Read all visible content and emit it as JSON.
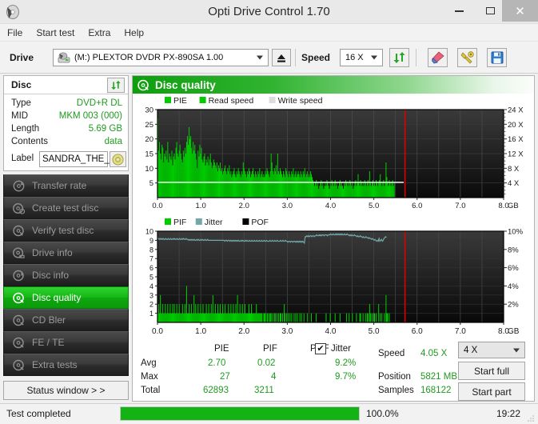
{
  "window": {
    "title": "Opti Drive Control 1.70",
    "icon": "disc-icon",
    "minimize": "–",
    "maximize": "□",
    "close": "✕"
  },
  "menu": {
    "items": [
      "File",
      "Start test",
      "Extra",
      "Help"
    ]
  },
  "toolbar": {
    "drive_label": "Drive",
    "drive_value": "(M:)   PLEXTOR DVDR   PX-890SA 1.00",
    "eject_icon": "eject-icon",
    "speed_label": "Speed",
    "speed_value": "16 X",
    "refresh_icon": "refresh-icon",
    "erase_icon": "erase-icon",
    "tools_icon": "tools-icon",
    "save_icon": "save-icon"
  },
  "disc_panel": {
    "header": "Disc",
    "refresh_icon": "refresh-icon",
    "rows": [
      {
        "key": "Type",
        "value": "DVD+R DL"
      },
      {
        "key": "MID",
        "value": "MKM 003 (000)"
      },
      {
        "key": "Length",
        "value": "5.69 GB"
      },
      {
        "key": "Contents",
        "value": "data"
      }
    ],
    "label_key": "Label",
    "label_value": "SANDRA_THE_",
    "label_button_icon": "disc-icon"
  },
  "sidebar": {
    "items": [
      {
        "label": "Transfer rate",
        "icon": "disc-transfer-icon",
        "active": false
      },
      {
        "label": "Create test disc",
        "icon": "disc-create-icon",
        "active": false
      },
      {
        "label": "Verify test disc",
        "icon": "disc-verify-icon",
        "active": false
      },
      {
        "label": "Drive info",
        "icon": "disc-drive-icon",
        "active": false
      },
      {
        "label": "Disc info",
        "icon": "disc-info-icon",
        "active": false
      },
      {
        "label": "Disc quality",
        "icon": "disc-quality-icon",
        "active": true
      },
      {
        "label": "CD Bler",
        "icon": "disc-bler-icon",
        "active": false
      },
      {
        "label": "FE / TE",
        "icon": "disc-fete-icon",
        "active": false
      },
      {
        "label": "Extra tests",
        "icon": "disc-extra-icon",
        "active": false
      }
    ],
    "status_window_button": "Status window > >"
  },
  "main": {
    "header_title": "Disc quality",
    "header_icon": "disc-quality-icon"
  },
  "stats": {
    "col_headers": [
      "PIE",
      "PIF",
      "POF",
      "Jitter"
    ],
    "jitter_checked": "✔",
    "rows": [
      {
        "name": "Avg",
        "pie": "2.70",
        "pif": "0.02",
        "pof": "",
        "jitter": "9.2%"
      },
      {
        "name": "Max",
        "pie": "27",
        "pif": "4",
        "pof": "",
        "jitter": "9.7%"
      },
      {
        "name": "Total",
        "pie": "62893",
        "pif": "3211",
        "pof": "",
        "jitter": ""
      }
    ],
    "speed_key": "Speed",
    "speed_value": "4.05 X",
    "position_key": "Position",
    "position_value": "5821 MB",
    "samples_key": "Samples",
    "samples_value": "168122",
    "test_speed_select": "4 X",
    "start_full_button": "Start full",
    "start_part_button": "Start part"
  },
  "statusbar": {
    "message": "Test completed",
    "progress_percent": 100.0,
    "progress_text": "100.0%",
    "elapsed": "19:22"
  },
  "colors": {
    "pie_green": "#00cc00",
    "pif_green": "#3fd820",
    "jitter_teal": "#72a8a8",
    "pof_black": "#000000",
    "marker_red": "#dd0000",
    "avg_line_white": "#ffffff",
    "plot_bg_dark": "#1d1d1d",
    "accent_green": "#16b816"
  },
  "chart_data": [
    {
      "id": "pie-chart",
      "type": "area",
      "title": "PIE",
      "legend": [
        "PIE",
        "Read speed",
        "Write speed"
      ],
      "legend_colors": [
        "#00cc00",
        "#00cc00",
        "#dcdcdc"
      ],
      "xlabel": "GB",
      "xlim": [
        0.0,
        8.0
      ],
      "xticks": [
        "0.0",
        "1.0",
        "2.0",
        "3.0",
        "4.0",
        "5.0",
        "6.0",
        "7.0",
        "8.0"
      ],
      "ylabel_left": "PIE",
      "ylim": [
        0,
        30
      ],
      "yticks": [
        5,
        10,
        15,
        20,
        25,
        30
      ],
      "ylabel_right": "Speed",
      "ylim_right": [
        0,
        24
      ],
      "yticks_right": [
        "4 X",
        "8 X",
        "12 X",
        "16 X",
        "20 X",
        "24 X"
      ],
      "avg_line": 2.7,
      "read_speed_line_x": 4.0,
      "data_end_gb": 5.69,
      "marker_line_gb": 5.72,
      "grid": true,
      "values": [
        27,
        16,
        19,
        15,
        13,
        18,
        17,
        12,
        15,
        14,
        16,
        13,
        19,
        12,
        15,
        14,
        13,
        16,
        11,
        14,
        15,
        13,
        17,
        19,
        15,
        14,
        16,
        18,
        15,
        13,
        12,
        16,
        14,
        17,
        15,
        19,
        21,
        18,
        24,
        20,
        21,
        17,
        15,
        19,
        16,
        18,
        15,
        13,
        10,
        16,
        14,
        18,
        15,
        17,
        13,
        12,
        14,
        15,
        11,
        13,
        12,
        14,
        11,
        13,
        15,
        12,
        10,
        11,
        13,
        12,
        11,
        10,
        12,
        9,
        11,
        10,
        12,
        9,
        10,
        8,
        9,
        10,
        11,
        9,
        8,
        10,
        9,
        11,
        8,
        9,
        7,
        8,
        9,
        10,
        8,
        7,
        9,
        8,
        10,
        9,
        8,
        7,
        9,
        8,
        12,
        10,
        9,
        8,
        7,
        9,
        8,
        10,
        9,
        7,
        8,
        9,
        10,
        8,
        7,
        9,
        8,
        7,
        9,
        8,
        10,
        7,
        8,
        9,
        7,
        8,
        7,
        9,
        8,
        10,
        9,
        8,
        7,
        9,
        15,
        12,
        9,
        8,
        10,
        9,
        11,
        8,
        15,
        9,
        8,
        10,
        9,
        8,
        7,
        9,
        8,
        7,
        10,
        9,
        8,
        7,
        9,
        8,
        7,
        9,
        8,
        10,
        7,
        8,
        9,
        7,
        8,
        9,
        8,
        7,
        9,
        8,
        7,
        9,
        8,
        10,
        7,
        8,
        9,
        7,
        8,
        7,
        9,
        8,
        7,
        6,
        5,
        4,
        5,
        6,
        4,
        5,
        3,
        4,
        5,
        6,
        4,
        5,
        3,
        4,
        5,
        4,
        6,
        5,
        4,
        3,
        5,
        4,
        6,
        5,
        4,
        5,
        6,
        4,
        5,
        3,
        4,
        5,
        6,
        4,
        5,
        4,
        3,
        5,
        4,
        6,
        5,
        4,
        5,
        4,
        6,
        5,
        4,
        5,
        3,
        4,
        5,
        6,
        4,
        5,
        8,
        5,
        4,
        6,
        5,
        4,
        5,
        4,
        6,
        5,
        4,
        5,
        6,
        4,
        9,
        5,
        4,
        5,
        6,
        4,
        5,
        4,
        6,
        5,
        4,
        5,
        6,
        8,
        5,
        4,
        5,
        6,
        4,
        5,
        12,
        7,
        5,
        4,
        6,
        5,
        4,
        5,
        6,
        4,
        5,
        0,
        0,
        0,
        0,
        0,
        0,
        0,
        0,
        0,
        0,
        0
      ]
    },
    {
      "id": "pif-jitter-chart",
      "type": "line+bar",
      "title": "PIF / Jitter / POF",
      "legend": [
        "PIF",
        "Jitter",
        "POF"
      ],
      "legend_colors": [
        "#00cc00",
        "#72a8a8",
        "#000000"
      ],
      "xlabel": "GB",
      "xlim": [
        0.0,
        8.0
      ],
      "xticks": [
        "0.0",
        "1.0",
        "2.0",
        "3.0",
        "4.0",
        "5.0",
        "6.0",
        "7.0",
        "8.0"
      ],
      "ylabel_left": "PIF",
      "ylim": [
        0,
        10
      ],
      "yticks": [
        1,
        2,
        3,
        4,
        5,
        6,
        7,
        8,
        9,
        10
      ],
      "ylabel_right": "Jitter",
      "ylim_right": [
        0,
        10
      ],
      "yticks_right": [
        "2%",
        "4%",
        "6%",
        "8%",
        "10%"
      ],
      "data_end_gb": 5.69,
      "marker_line_gb": 5.72,
      "grid": true,
      "series": [
        {
          "name": "PIF",
          "values": [
            1,
            2,
            1,
            3,
            1,
            1,
            2,
            1,
            1,
            2,
            1,
            1,
            2,
            1,
            1,
            2,
            1,
            1,
            2,
            1,
            2,
            1,
            1,
            2,
            1,
            1,
            2,
            1,
            1,
            1,
            2,
            1,
            1,
            2,
            1,
            4,
            1,
            1,
            2,
            1,
            1,
            2,
            1,
            1,
            3,
            1,
            2,
            1,
            1,
            2,
            1,
            1,
            2,
            1,
            1,
            2,
            1,
            1,
            1,
            2,
            1,
            1,
            2,
            1,
            1,
            2,
            1,
            3,
            1,
            1,
            2,
            1,
            1,
            2,
            1,
            1,
            2,
            1,
            1,
            2,
            1,
            1,
            2,
            1,
            1,
            1,
            2,
            1,
            1,
            2,
            1,
            1,
            2,
            1,
            1,
            2,
            1,
            3,
            1,
            1,
            2,
            1,
            1,
            2,
            1,
            1,
            2,
            1,
            1,
            1,
            1,
            2,
            1,
            1,
            2,
            1,
            1,
            1,
            1,
            1,
            2,
            1,
            1,
            1,
            1,
            1,
            1,
            1,
            0,
            1,
            1,
            1,
            0,
            1,
            1,
            0,
            1,
            1,
            1,
            0,
            1,
            0,
            1,
            1,
            0,
            1,
            0,
            1,
            0,
            1,
            1,
            0,
            1,
            0,
            2,
            1,
            0,
            1,
            0,
            1,
            0,
            1,
            0,
            1,
            0,
            0,
            1,
            0,
            1,
            0,
            1,
            0,
            0,
            1,
            0,
            1,
            0,
            0,
            1,
            0,
            0,
            0,
            1,
            0,
            0,
            0,
            0,
            1,
            0,
            0,
            0,
            0,
            0,
            1,
            0,
            0,
            0,
            0,
            0,
            0,
            0,
            0,
            0,
            0,
            0,
            1,
            0,
            0,
            0,
            0,
            1,
            0,
            0,
            0,
            0,
            0,
            1,
            0,
            0,
            0,
            0,
            0,
            1,
            0,
            0,
            0,
            0,
            0,
            0,
            0,
            1,
            0,
            0,
            1,
            0,
            0,
            0,
            1,
            0,
            0,
            0,
            0,
            1,
            0,
            0,
            0,
            1,
            1,
            0,
            0,
            1,
            0,
            0,
            1,
            0,
            1,
            1,
            0,
            2,
            1,
            0,
            1,
            0,
            1,
            1,
            0,
            1,
            0,
            0,
            2,
            0,
            1,
            0,
            1,
            0,
            0,
            1,
            0,
            3,
            1,
            1,
            0,
            1,
            0,
            0,
            0,
            0,
            0,
            0,
            0,
            0,
            0,
            0,
            0,
            0,
            0,
            0,
            0,
            0,
            0
          ]
        },
        {
          "name": "Jitter",
          "values": [
            9.3,
            9.2,
            9.1,
            9.2,
            9.1,
            9.2,
            9.1,
            9.2,
            9.1,
            9.1,
            9.2,
            9.1,
            9.1,
            9.2,
            9.1,
            9.1,
            9.2,
            9.1,
            9.1,
            9.2,
            9.1,
            9.2,
            9.1,
            9.1,
            9.2,
            9.1,
            9.1,
            9.2,
            9.1,
            9.1,
            9.2,
            9.1,
            9.2,
            9.1,
            9.1,
            9.2,
            9.1,
            9.1,
            9.0,
            9.1,
            9.0,
            9.1,
            9.0,
            9.1,
            9.0,
            9.1,
            9.0,
            9.0,
            9.1,
            9.0,
            9.1,
            9.0,
            9.0,
            9.1,
            9.0,
            9.1,
            9.0,
            9.0,
            9.1,
            9.0,
            9.0,
            9.1,
            9.0,
            9.0,
            9.0,
            9.0,
            9.0,
            9.0,
            9.0,
            9.0,
            9.0,
            9.0,
            9.0,
            9.0,
            9.0,
            9.0,
            9.0,
            9.0,
            9.0,
            9.0,
            9.0,
            9.0,
            8.9,
            9.0,
            9.0,
            8.9,
            9.0,
            9.0,
            8.9,
            9.0,
            8.9,
            9.0,
            8.9,
            9.0,
            8.9,
            9.0,
            8.9,
            9.0,
            8.9,
            9.0,
            8.9,
            8.9,
            9.0,
            8.9,
            9.0,
            8.9,
            8.9,
            9.0,
            8.9,
            9.0,
            8.9,
            8.9,
            9.0,
            8.9,
            8.9,
            9.0,
            8.9,
            8.9,
            9.0,
            8.9,
            8.9,
            9.0,
            8.9,
            8.9,
            9.0,
            8.9,
            8.9,
            9.0,
            8.9,
            8.9,
            9.0,
            8.9,
            8.9,
            9.0,
            8.9,
            8.9,
            8.9,
            9.0,
            8.9,
            8.9,
            9.0,
            8.9,
            8.9,
            9.0,
            8.9,
            8.9,
            9.0,
            8.9,
            8.9,
            8.9,
            9.0,
            8.9,
            8.9,
            9.0,
            8.9,
            8.9,
            9.0,
            8.9,
            8.9,
            8.8,
            8.9,
            8.9,
            8.8,
            8.9,
            8.9,
            8.8,
            8.9,
            8.9,
            8.8,
            8.9,
            8.8,
            8.9,
            8.8,
            8.9,
            8.8,
            8.9,
            8.8,
            8.9,
            8.8,
            8.7,
            9.4,
            9.4,
            9.5,
            9.4,
            9.5,
            9.4,
            9.5,
            9.5,
            9.4,
            9.5,
            9.5,
            9.4,
            9.5,
            9.5,
            9.6,
            9.5,
            9.5,
            9.6,
            9.5,
            9.6,
            9.5,
            9.6,
            9.6,
            9.5,
            9.6,
            9.6,
            9.6,
            9.5,
            9.6,
            9.6,
            9.6,
            9.7,
            9.6,
            9.6,
            9.7,
            9.6,
            9.6,
            9.7,
            9.6,
            9.7,
            9.6,
            9.7,
            9.6,
            9.7,
            9.6,
            9.7,
            9.6,
            9.6,
            9.7,
            9.6,
            9.6,
            9.7,
            9.6,
            9.6,
            9.5,
            9.6,
            9.5,
            9.6,
            9.5,
            9.5,
            9.6,
            9.5,
            9.5,
            9.4,
            9.5,
            9.4,
            9.4,
            9.5,
            9.4,
            9.4,
            9.3,
            9.4,
            9.3,
            9.3,
            9.4,
            9.3,
            9.3,
            9.2,
            9.3,
            9.2,
            9.2,
            9.1,
            9.2,
            9.1,
            9.0,
            9.1,
            9.0,
            8.9,
            9.0,
            8.9,
            9.2,
            8.9,
            9.0,
            9.1,
            8.9,
            9.0,
            9.2,
            9.3,
            9.4,
            9.3,
            null,
            null,
            null,
            null,
            null,
            null,
            null,
            null,
            null,
            null,
            null,
            null,
            null,
            null,
            null,
            null,
            null,
            null,
            null,
            null
          ]
        }
      ]
    }
  ]
}
